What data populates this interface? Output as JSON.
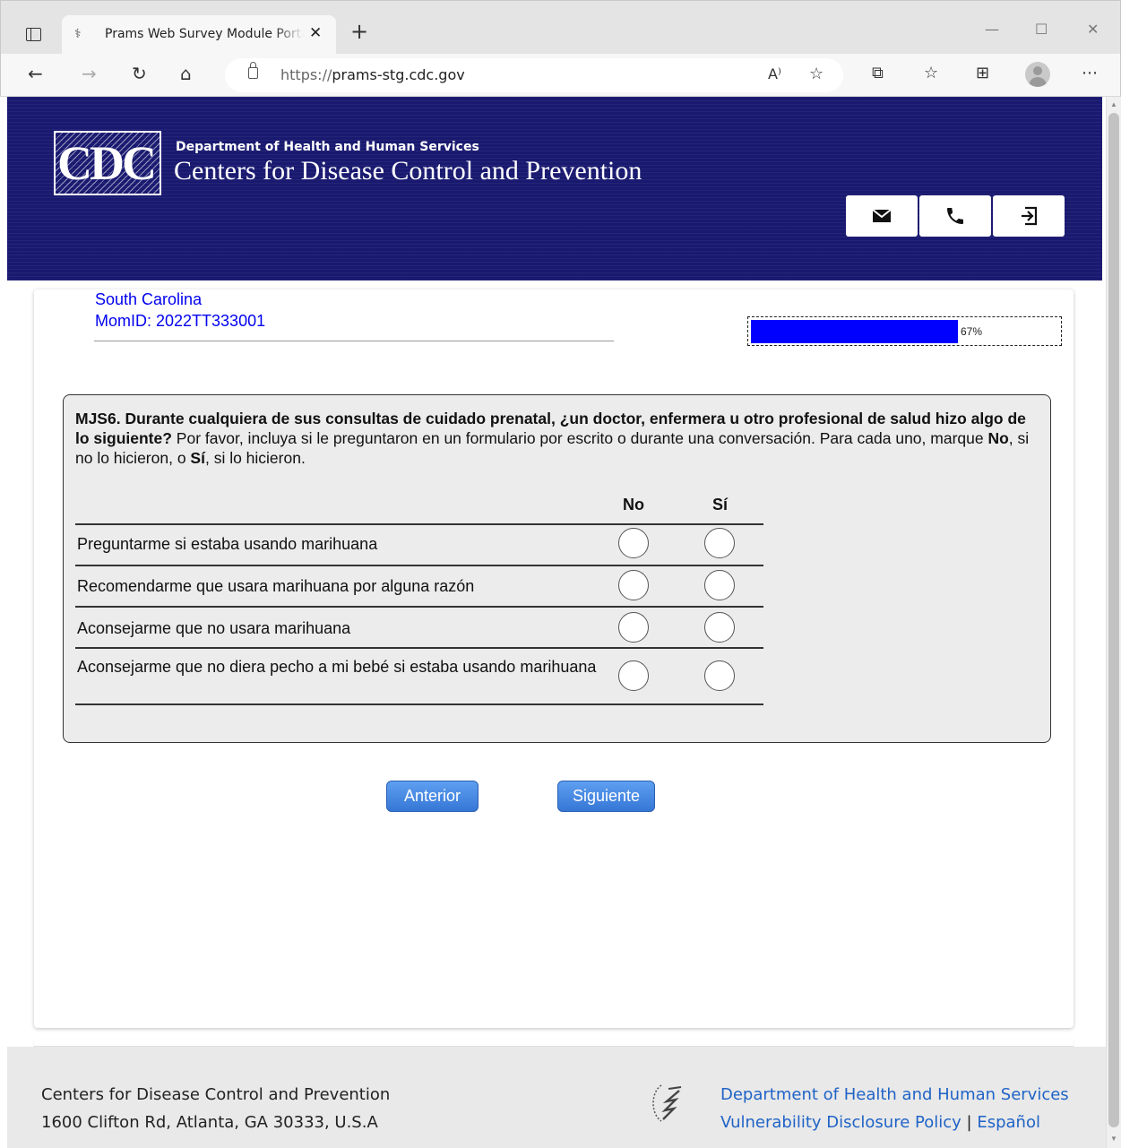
{
  "browser": {
    "tab_title": "Prams Web Survey Module Portal",
    "tab_close": "✕",
    "new_tab": "+",
    "url_scheme": "https://",
    "url_host": "prams-stg.cdc.gov",
    "window_controls": {
      "minimize": "—",
      "maximize": "☐",
      "close": "✕"
    },
    "icons": [
      "back-icon",
      "forward-icon",
      "refresh-icon",
      "home-icon",
      "lock-icon",
      "read-aloud-icon",
      "favorite-add-icon",
      "extensions-icon",
      "favorites-icon",
      "collections-icon",
      "profile-icon",
      "more-icon"
    ]
  },
  "header": {
    "logo_text": "CDC",
    "dept": "Department of Health and Human Services",
    "agency": "Centers for Disease Control and Prevention",
    "icons": [
      "mail-icon",
      "phone-icon",
      "sign-out-icon"
    ],
    "bg_color": "#191970"
  },
  "respondent": {
    "state": "South Carolina",
    "momid": "MomID: 2022TT333001"
  },
  "progress": {
    "value": 0.67,
    "label": "67%",
    "color": "#0000ff"
  },
  "question": {
    "id_bold": "MJS6. Durante cualquiera de sus consultas de cuidado prenatal, ¿un doctor, enfermera u otro profesional de salud hizo algo de lo siguiente?",
    "instruction_a": " Por favor, incluya si le preguntaron en un formulario por escrito o durante una conversación. Para cada uno, marque ",
    "no_word": "No",
    "instruction_b": ", si no lo hicieron, o ",
    "si_word": "Sí",
    "instruction_c": ", si lo hicieron.",
    "col_no": "No",
    "col_si": "Sí",
    "rows": [
      {
        "label": "Preguntarme si estaba usando marihuana"
      },
      {
        "label": "Recomendarme que usara marihuana por alguna razón"
      },
      {
        "label": "Aconsejarme que no usara marihuana"
      },
      {
        "label": "Aconsejarme que no diera pecho a mi bebé si estaba usando marihuana"
      }
    ]
  },
  "nav": {
    "prev": "Anterior",
    "next": "Siguiente"
  },
  "footer": {
    "org": "Centers for Disease Control and Prevention",
    "address": "1600 Clifton Rd, Atlanta, GA 30333, U.S.A",
    "link_hhs": "Department of Health and Human Services",
    "link_vdp": "Vulnerability Disclosure Policy",
    "sep": "|",
    "link_es": "Español",
    "link_color": "#1f63c6"
  }
}
